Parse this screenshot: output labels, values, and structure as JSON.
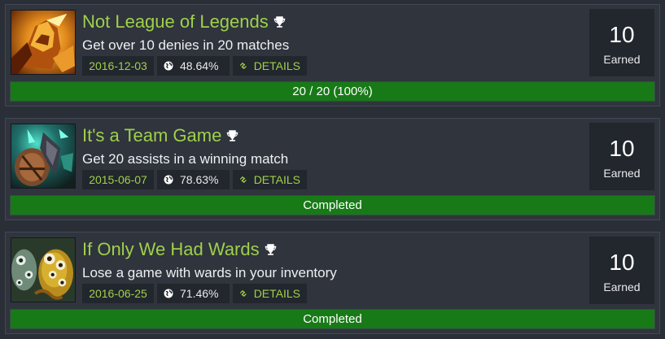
{
  "colors": {
    "title": "#9fd04a",
    "progress_fill": "#187a17",
    "card_bg": "#2f343d",
    "pill_bg": "#22262d"
  },
  "achievements": [
    {
      "title": "Not League of Legends",
      "description": "Get over 10 denies in 20 matches",
      "date": "2016-12-03",
      "percent": "48.64%",
      "details_label": "DETAILS",
      "points": "10",
      "earned_label": "Earned",
      "progress_text": "20 / 20 (100%)",
      "progress_fraction": 1.0,
      "icon": "golden-helmet-hero-icon"
    },
    {
      "title": "It's a Team Game",
      "description": "Get 20 assists in a winning match",
      "date": "2015-06-07",
      "percent": "78.63%",
      "details_label": "DETAILS",
      "points": "10",
      "earned_label": "Earned",
      "progress_text": "Completed",
      "progress_fraction": 1.0,
      "icon": "shield-ghost-hero-icon"
    },
    {
      "title": "If Only We Had Wards",
      "description": "Lose a game with wards in your inventory",
      "date": "2016-06-25",
      "percent": "71.46%",
      "details_label": "DETAILS",
      "points": "10",
      "earned_label": "Earned",
      "progress_text": "Completed",
      "progress_fraction": 1.0,
      "icon": "eyeball-creatures-icon"
    }
  ]
}
